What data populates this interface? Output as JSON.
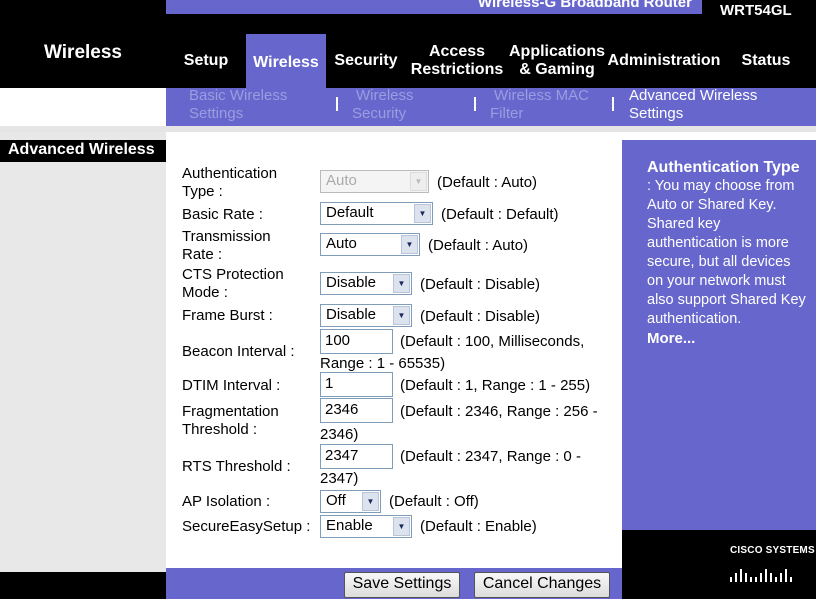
{
  "header": {
    "product_name": "Wireless-G Broadband Router",
    "model": "WRT54GL",
    "section_title": "Wireless"
  },
  "tabs": [
    {
      "label": "Setup"
    },
    {
      "label": "Wireless"
    },
    {
      "label": "Security"
    },
    {
      "line1": "Access",
      "line2": "Restrictions"
    },
    {
      "line1": "Applications",
      "line2": "& Gaming"
    },
    {
      "label": "Administration"
    },
    {
      "label": "Status"
    }
  ],
  "subtabs": [
    {
      "line1": "Basic Wireless",
      "line2": "Settings"
    },
    {
      "line1": "Wireless",
      "line2": "Security"
    },
    {
      "line1": "Wireless MAC",
      "line2": "Filter"
    },
    {
      "line1": "Advanced Wireless",
      "line2": "Settings"
    }
  ],
  "sidebar": {
    "title": "Advanced Wireless"
  },
  "form": {
    "auth_type": {
      "line1": "Authentication",
      "line2": "Type :",
      "value": "Auto",
      "note": "(Default : Auto)"
    },
    "basic_rate": {
      "label": "Basic Rate :",
      "value": "Default",
      "note": "(Default : Default)"
    },
    "transmission_rate": {
      "line1": "Transmission",
      "line2": "Rate :",
      "value": "Auto",
      "note": "(Default : Auto)"
    },
    "cts_protection": {
      "line1": "CTS Protection",
      "line2": "Mode :",
      "value": "Disable",
      "note": "(Default : Disable)"
    },
    "frame_burst": {
      "label": "Frame Burst :",
      "value": "Disable",
      "note": "(Default : Disable)"
    },
    "beacon_interval": {
      "label": "Beacon Interval :",
      "value": "100",
      "note1": "(Default : 100, Milliseconds,",
      "note2": "Range : 1 - 65535)"
    },
    "dtim_interval": {
      "label": "DTIM Interval :",
      "value": "1",
      "note": "(Default : 1, Range : 1 - 255)"
    },
    "fragmentation": {
      "line1": "Fragmentation",
      "line2": "Threshold :",
      "value": "2346",
      "note1": "(Default : 2346, Range : 256 -",
      "note2": "2346)"
    },
    "rts_threshold": {
      "label": "RTS Threshold :",
      "value": "2347",
      "note1": "(Default : 2347, Range : 0 -",
      "note2": "2347)"
    },
    "ap_isolation": {
      "label": "AP Isolation :",
      "value": "Off",
      "note": "(Default : Off)"
    },
    "secure_easy_setup": {
      "label": "SecureEasySetup :",
      "value": "Enable",
      "note": "(Default : Enable)"
    }
  },
  "help": {
    "title": "Authentication Type",
    "body": ": You may choose from Auto or Shared Key. Shared key authentication is more secure, but all devices on your network must also support Shared Key authentication.",
    "more": "More..."
  },
  "buttons": {
    "save": "Save Settings",
    "cancel": "Cancel Changes"
  },
  "footer": {
    "brand": "CISCO SYSTEMS"
  },
  "colors": {
    "accent": "#6666cc",
    "header_bg": "#000000",
    "sidebar_bg": "#e8e8e8"
  }
}
